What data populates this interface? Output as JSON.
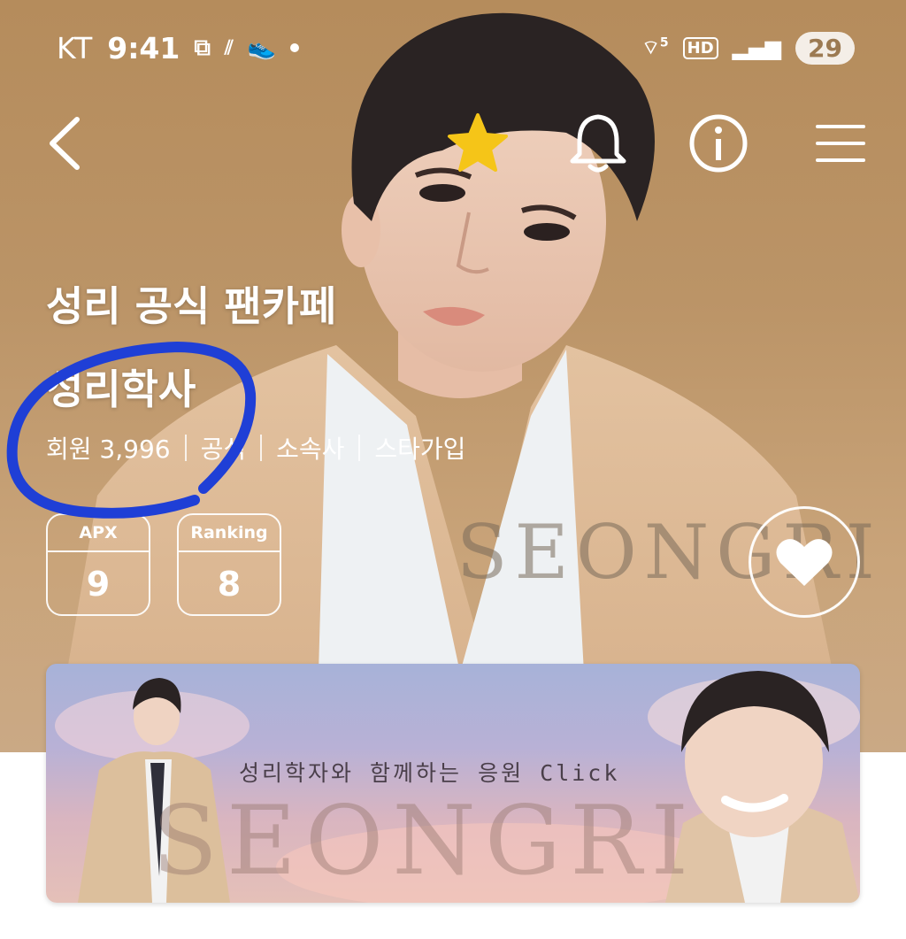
{
  "status_bar": {
    "carrier": "KT",
    "time": "9:41",
    "network_badge": "HD",
    "wifi_label": "5",
    "battery": "29"
  },
  "nav": {
    "back_icon": "chevron-left-icon",
    "favorite_icon": "star-icon",
    "notification_icon": "bell-icon",
    "info_icon": "info-icon",
    "menu_icon": "hamburger-icon",
    "favorite_color": "#f5c518"
  },
  "cafe": {
    "title_line1": "성리 공식 팬카페",
    "title_line2": "성리학사",
    "members_label": "회원 3,996",
    "tags": [
      "공식",
      "소속사",
      "스타가입"
    ]
  },
  "stats": [
    {
      "label": "APX",
      "value": "9"
    },
    {
      "label": "Ranking",
      "value": "8"
    }
  ],
  "hero_watermark": "SEONGRI",
  "like_button_icon": "heart-icon",
  "banner": {
    "caption": "성리학자와 함께하는 응원 Click",
    "watermark": "SEONGRI"
  },
  "annotation_color": "#1f3fd6"
}
